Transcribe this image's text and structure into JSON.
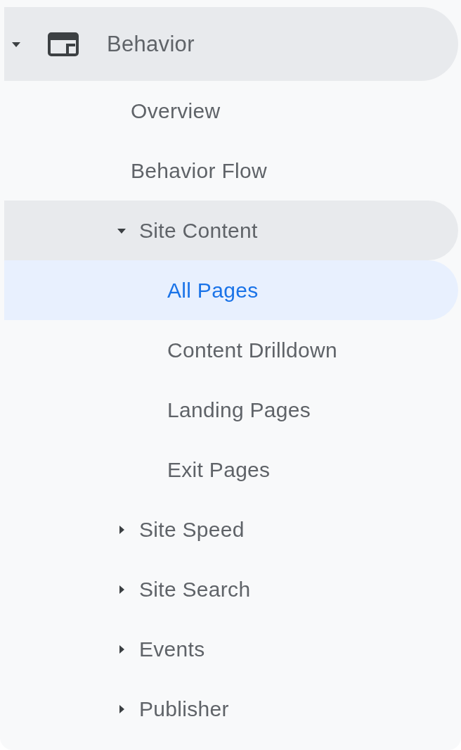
{
  "items": [
    {
      "label": "Behavior",
      "expanded": true,
      "selected": false,
      "children": [
        {
          "label": "Overview",
          "selected": false
        },
        {
          "label": "Behavior Flow",
          "selected": false
        },
        {
          "label": "Site Content",
          "expanded": true,
          "selected": false,
          "children": [
            {
              "label": "All Pages",
              "selected": true
            },
            {
              "label": "Content Drilldown",
              "selected": false
            },
            {
              "label": "Landing Pages",
              "selected": false
            },
            {
              "label": "Exit Pages",
              "selected": false
            }
          ]
        },
        {
          "label": "Site Speed",
          "expanded": false,
          "selected": false
        },
        {
          "label": "Site Search",
          "expanded": false,
          "selected": false
        },
        {
          "label": "Events",
          "expanded": false,
          "selected": false
        },
        {
          "label": "Publisher",
          "expanded": false,
          "selected": false
        }
      ]
    }
  ]
}
